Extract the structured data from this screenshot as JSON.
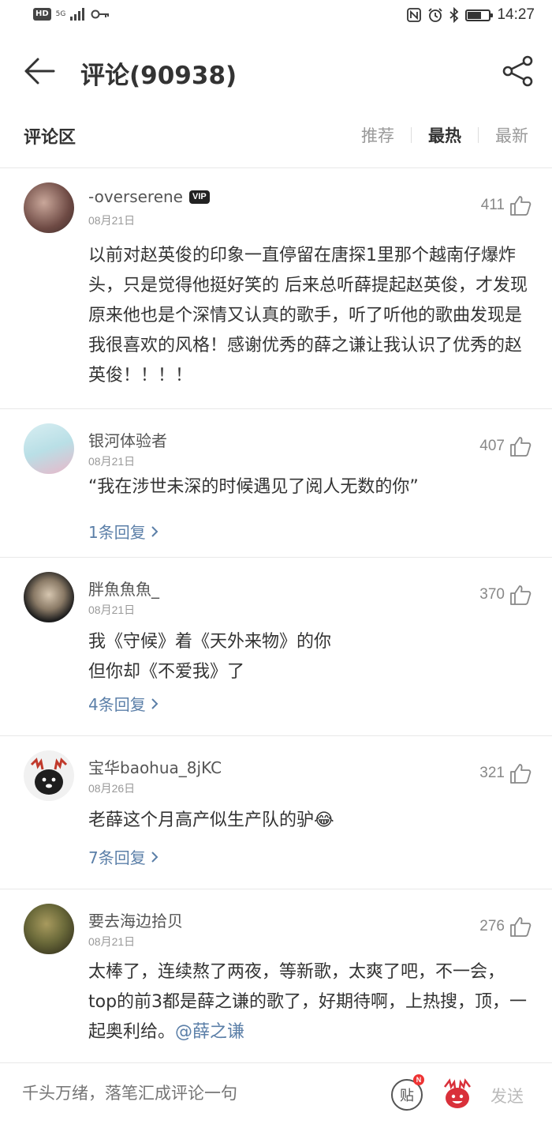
{
  "status_bar": {
    "hd": "HD",
    "signal": "5G",
    "time": "14:27",
    "icons": [
      "key-icon",
      "nfc-icon",
      "alarm-icon",
      "bluetooth-icon",
      "battery-icon"
    ]
  },
  "header": {
    "title": "评论(90938)",
    "back_icon": "arrow-left-icon",
    "share_icon": "share-icon"
  },
  "tabs": {
    "section_title": "评论区",
    "items": [
      {
        "label": "推荐",
        "active": false
      },
      {
        "label": "最热",
        "active": true
      },
      {
        "label": "最新",
        "active": false
      }
    ]
  },
  "comments": [
    {
      "nick": "-overserene",
      "vip": "VIP",
      "date": "08月21日",
      "likes": "411",
      "text": "以前对赵英俊的印象一直停留在唐探1里那个越南仔爆炸头，只是觉得他挺好笑的 后来总听薛提起赵英俊，才发现原来他也是个深情又认真的歌手，听了听他的歌曲发现是我很喜欢的风格！感谢优秀的薛之谦让我认识了优秀的赵英俊！！！！",
      "replies": ""
    },
    {
      "nick": "银河体验者",
      "date": "08月21日",
      "likes": "407",
      "text": "“我在涉世未深的时候遇见了阅人无数的你”",
      "replies": "1条回复"
    },
    {
      "nick": "胖魚魚魚_",
      "date": "08月21日",
      "likes": "370",
      "text_line1": "我《守候》着《天外来物》的你",
      "text_line2": "但你却《不爱我》了",
      "replies": "4条回复"
    },
    {
      "nick": "宝华baohua_8jKC",
      "date": "08月26日",
      "likes": "321",
      "text": "老薛这个月高产似生产队的驴",
      "emoji": "😂",
      "replies": "7条回复"
    },
    {
      "nick": "要去海边拾贝",
      "date": "08月21日",
      "likes": "276",
      "text": "太棒了，连续熬了两夜，等新歌，太爽了吧，不一会，top的前3都是薛之谦的歌了，好期待啊，上热搜，顶，一起奥利给。",
      "mention": "@薛之谦"
    }
  ],
  "bottom_bar": {
    "input_placeholder": "千头万绪，落笔汇成评论一句",
    "post_label": "贴",
    "post_badge": "N",
    "send_label": "发送"
  },
  "colors": {
    "link": "#5b7fa8",
    "text": "#333333",
    "muted": "#999999"
  }
}
